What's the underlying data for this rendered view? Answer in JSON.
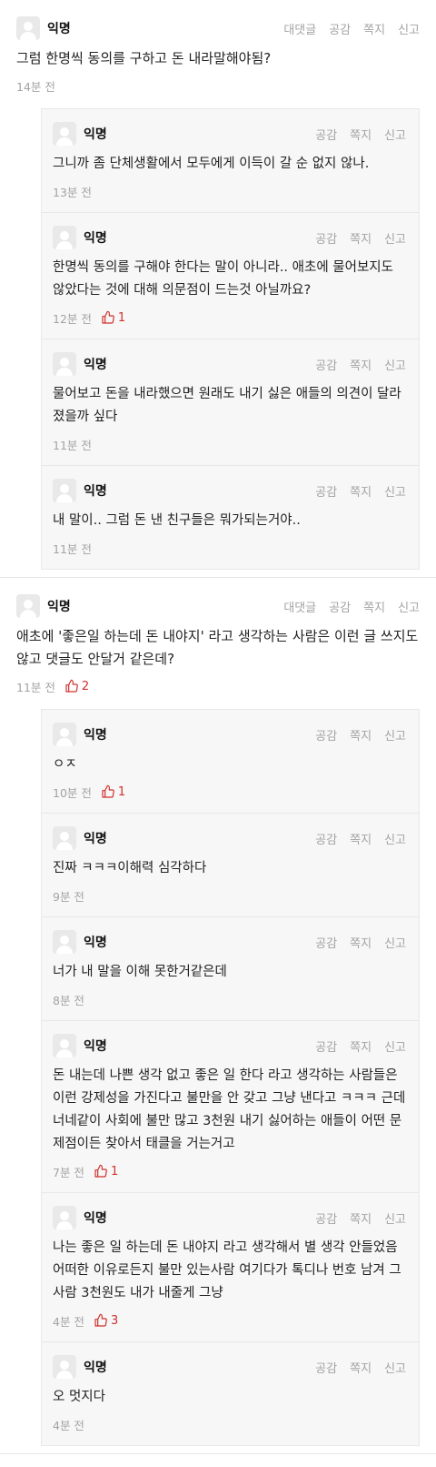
{
  "labels": {
    "reply": "대댓글",
    "like": "공감",
    "message": "쪽지",
    "report": "신고"
  },
  "colors": {
    "like_red": "#d0312d",
    "meta_gray": "#a3a3a3"
  },
  "icons": {
    "avatar": "user-avatar-icon",
    "like": "thumbs-up-icon"
  },
  "comments": [
    {
      "author": "익명",
      "text": "그럼 한명씩 동의를 구하고 돈 내라말해야됨?",
      "time": "14분 전",
      "likes": "",
      "replies": [
        {
          "author": "익명",
          "text": "그니까 좀 단체생활에서 모두에게 이득이 갈 순 없지 않나.",
          "time": "13분 전",
          "likes": ""
        },
        {
          "author": "익명",
          "text": "한명씩 동의를 구해야 한다는 말이 아니라.. 애초에 물어보지도 않았다는 것에 대해 의문점이 드는것 아닐까요?",
          "time": "12분 전",
          "likes": "1"
        },
        {
          "author": "익명",
          "text": "물어보고 돈을 내라했으면 원래도 내기 싫은 애들의 의견이 달라졌을까 싶다",
          "time": "11분 전",
          "likes": ""
        },
        {
          "author": "익명",
          "text": "내 말이.. 그럼 돈 낸 친구들은 뭐가되는거야..",
          "time": "11분 전",
          "likes": ""
        }
      ]
    },
    {
      "author": "익명",
      "text": "애초에 '좋은일 하는데 돈 내야지' 라고 생각하는 사람은 이런 글 쓰지도 않고 댓글도 안달거 같은데?",
      "time": "11분 전",
      "likes": "2",
      "replies": [
        {
          "author": "익명",
          "text": "ㅇㅈ",
          "time": "10분 전",
          "likes": "1"
        },
        {
          "author": "익명",
          "text": "진짜 ㅋㅋㅋ이해력 심각하다",
          "time": "9분 전",
          "likes": ""
        },
        {
          "author": "익명",
          "text": "너가 내 말을 이해 못한거같은데",
          "time": "8분 전",
          "likes": ""
        },
        {
          "author": "익명",
          "text": "돈 내는데 나쁜 생각 없고 좋은 일 한다 라고 생각하는 사람들은 이런 강제성을 가진다고 불만을 안 갖고 그냥 낸다고 ㅋㅋㅋ 근데 너네같이 사회에 불만 많고 3천원 내기 싫어하는 애들이 어떤 문제점이든 찾아서 태클을 거는거고",
          "time": "7분 전",
          "likes": "1"
        },
        {
          "author": "익명",
          "text": "나는 좋은 일 하는데 돈 내야지 라고 생각해서 별 생각 안들었음 어떠한 이유로든지 불만 있는사람 여기다가 톡디나 번호 남겨 그 사람 3천원도 내가 내줄게 그냥",
          "time": "4분 전",
          "likes": "3"
        },
        {
          "author": "익명",
          "text": "오 멋지다",
          "time": "4분 전",
          "likes": ""
        }
      ]
    }
  ]
}
